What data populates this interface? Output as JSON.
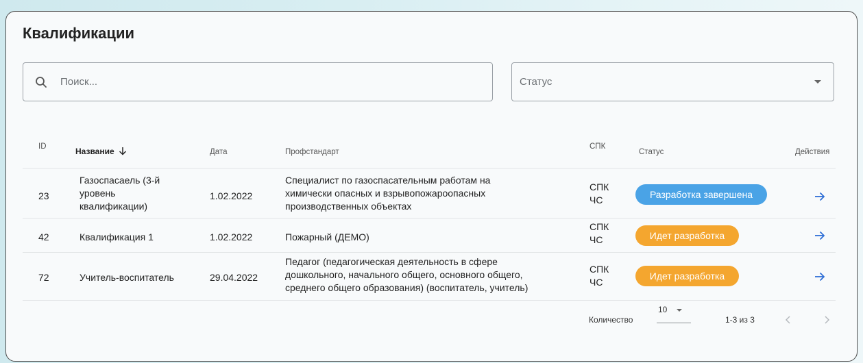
{
  "title": "Квалификации",
  "search": {
    "placeholder": "Поиск...",
    "value": ""
  },
  "status_filter": {
    "placeholder": "Статус"
  },
  "table": {
    "headers": {
      "id": "ID",
      "name": "Название",
      "date": "Дата",
      "profstandard": "Профстандарт",
      "spk": "СПК",
      "status": "Статус",
      "actions": "Действия"
    },
    "rows": [
      {
        "id": "23",
        "name_lines": [
          "Газоспасаель (3-й",
          "уровень",
          "квалификации)"
        ],
        "date": "1.02.2022",
        "profstandard_lines": [
          "Специалист по газоспасательным работам на",
          "химически опасных и взрывопожароопасных",
          "производственных объектах"
        ],
        "spk_lines": [
          "СПК",
          "ЧС"
        ],
        "status": "Разработка завершена",
        "status_color": "#4aa3e6"
      },
      {
        "id": "42",
        "name_lines": [
          "Квалификация 1"
        ],
        "date": "1.02.2022",
        "profstandard_lines": [
          "Пожарный (ДЕМО)"
        ],
        "spk_lines": [
          "СПК",
          "ЧС"
        ],
        "status": "Идет разработка",
        "status_color": "#f4a62f"
      },
      {
        "id": "72",
        "name_lines": [
          "Учитель-воспитатель"
        ],
        "date": "29.04.2022",
        "profstandard_lines": [
          "Педагог (педагогическая деятельность в сфере",
          "дошкольного, начального общего, основного общего,",
          "среднего общего образования) (воспитатель, учитель)"
        ],
        "spk_lines": [
          "СПК",
          "ЧС"
        ],
        "status": "Идет разработка",
        "status_color": "#f4a62f"
      }
    ]
  },
  "pagination": {
    "rows_label": "Количество",
    "rows_per_page": "10",
    "range": "1-3 из 3"
  },
  "icons": {
    "search": "search-icon",
    "sort": "arrow-down-icon",
    "action": "arrow-right-icon",
    "prev": "chevron-left-icon",
    "next": "chevron-right-icon"
  },
  "colors": {
    "accent_blue": "#2f6fd6",
    "badge_blue": "#4aa3e6",
    "badge_orange": "#f4a62f"
  }
}
